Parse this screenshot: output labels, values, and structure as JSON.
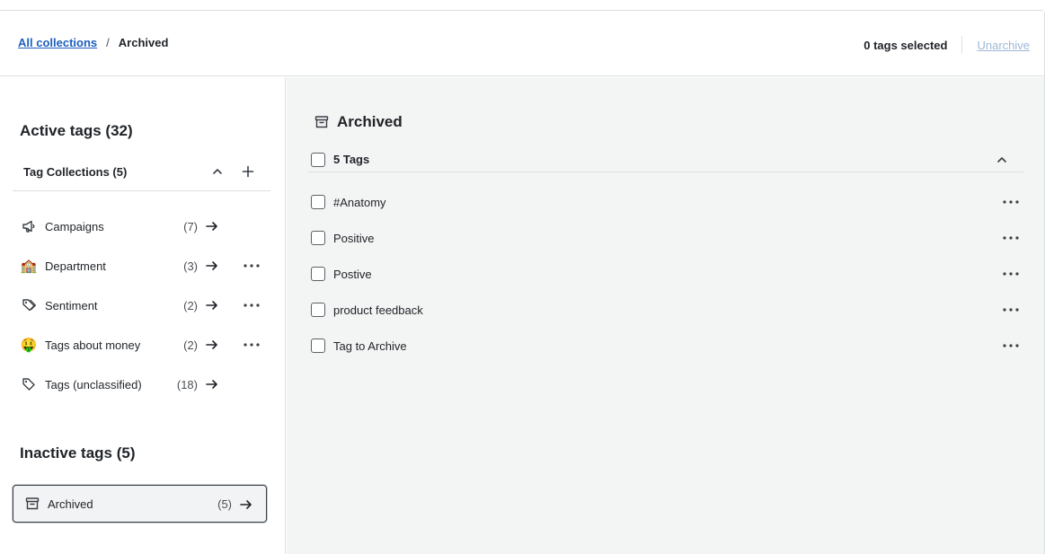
{
  "breadcrumb": {
    "root_label": "All collections",
    "separator": "/",
    "current_label": "Archived"
  },
  "header": {
    "selected_count": "0 tags selected",
    "unarchive_label": "Unarchive"
  },
  "sidebar": {
    "active_title": "Active tags (32)",
    "collections_label": "Tag Collections (5)",
    "collections": [
      {
        "name": "Campaigns",
        "count": "(7)",
        "icon": "megaphone-icon",
        "has_more": false
      },
      {
        "name": "Department",
        "count": "(3)",
        "icon": "school-emoji",
        "emoji": "🏫",
        "has_more": true
      },
      {
        "name": "Sentiment",
        "count": "(2)",
        "icon": "tags-icon",
        "has_more": true
      },
      {
        "name": "Tags about money",
        "count": "(2)",
        "icon": "money-mouth-emoji",
        "emoji": "🤑",
        "has_more": true
      },
      {
        "name": "Tags (unclassified)",
        "count": "(18)",
        "icon": "tag-icon",
        "has_more": false
      }
    ],
    "inactive_title": "Inactive tags (5)",
    "archived": {
      "name": "Archived",
      "count": "(5)",
      "icon": "archive-box-icon"
    }
  },
  "main": {
    "title": "Archived",
    "group_label": "5 Tags",
    "tags": [
      {
        "label": "#Anatomy"
      },
      {
        "label": "Positive"
      },
      {
        "label": "Postive"
      },
      {
        "label": "product feedback"
      },
      {
        "label": "Tag to Archive"
      }
    ]
  },
  "colors": {
    "link": "#1d5fbf",
    "disabled_link": "#9fb7d8",
    "main_bg": "#f3f4f4",
    "border": "#dcdfe3"
  }
}
